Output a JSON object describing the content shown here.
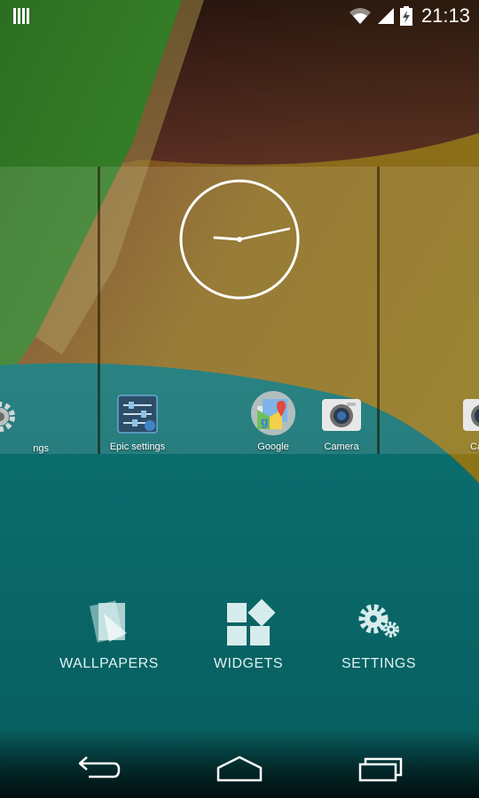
{
  "status_bar": {
    "time": "21:13",
    "icons": [
      "notification-bars-icon",
      "wifi-icon",
      "cell-signal-icon",
      "battery-charging-icon"
    ]
  },
  "home_screen": {
    "clock_widget": "analog-clock",
    "apps": [
      {
        "label": "ngs",
        "icon": "settings-gear-icon"
      },
      {
        "label": "Epic settings",
        "icon": "epic-settings-icon"
      },
      {
        "label": "Google",
        "icon": "google-maps-folder-icon"
      },
      {
        "label": "Camera",
        "icon": "camera-icon"
      },
      {
        "label": "Ca",
        "icon": "camera-icon"
      }
    ]
  },
  "overview_menu": {
    "items": [
      {
        "label": "WALLPAPERS",
        "icon": "wallpapers-icon"
      },
      {
        "label": "WIDGETS",
        "icon": "widgets-icon"
      },
      {
        "label": "SETTINGS",
        "icon": "settings-gears-icon"
      }
    ]
  },
  "nav_bar": {
    "buttons": [
      "back-icon",
      "home-icon",
      "recents-icon"
    ]
  },
  "colors": {
    "teal": "#0a6a6b",
    "green": "#2a7a28",
    "maroon": "#5c2a28",
    "olive": "#8a7418"
  }
}
